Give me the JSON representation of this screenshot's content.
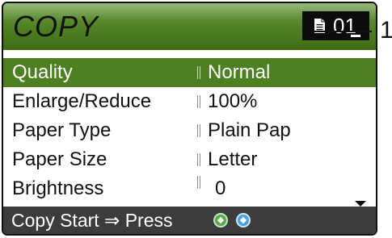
{
  "screen": {
    "title": "COPY",
    "copies_count": "01",
    "copies_icon": "document-icon"
  },
  "menu": {
    "items": [
      {
        "label": "Quality",
        "value": "Normal",
        "selected": true
      },
      {
        "label": "Enlarge/Reduce",
        "value": "100%",
        "selected": false
      },
      {
        "label": "Paper Type",
        "value": "Plain Pap",
        "selected": false
      },
      {
        "label": "Paper Size",
        "value": "Letter",
        "selected": false
      },
      {
        "label": "Brightness",
        "value": "0",
        "selected": false
      }
    ]
  },
  "footer": {
    "text": "Copy Start ⇒ Press",
    "icons": [
      "mono-start-icon",
      "colour-start-icon"
    ]
  },
  "callout": {
    "number": "1"
  },
  "colors": {
    "accent_green": "#4e7f22",
    "footer_bg": "#3c3c3c",
    "count_box_bg": "#0c0c0c",
    "mono_start": "#5aa84a",
    "colour_start": "#4aa3df"
  }
}
